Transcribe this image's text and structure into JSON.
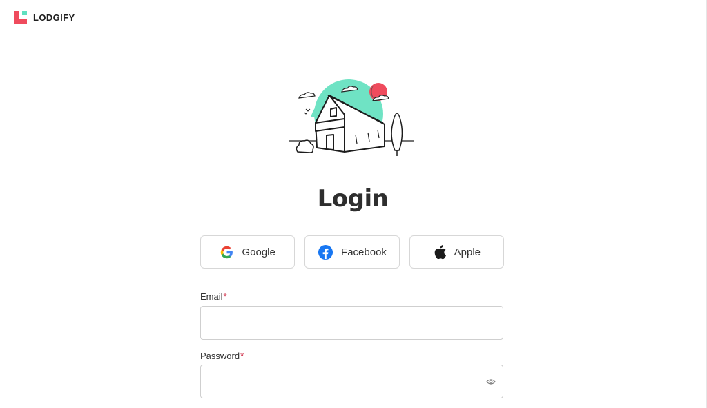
{
  "brand": {
    "name": "LODGIFY",
    "accent_color": "#ef4b5d",
    "secondary_color": "#5fe0bf"
  },
  "page": {
    "title": "Login"
  },
  "social": [
    {
      "label": "Google",
      "icon": "google-icon"
    },
    {
      "label": "Facebook",
      "icon": "facebook-icon"
    },
    {
      "label": "Apple",
      "icon": "apple-icon"
    }
  ],
  "form": {
    "email": {
      "label": "Email",
      "required_mark": "*",
      "value": "",
      "placeholder": ""
    },
    "password": {
      "label": "Password",
      "required_mark": "*",
      "value": "",
      "placeholder": "",
      "toggle_icon": "eye-icon"
    }
  }
}
